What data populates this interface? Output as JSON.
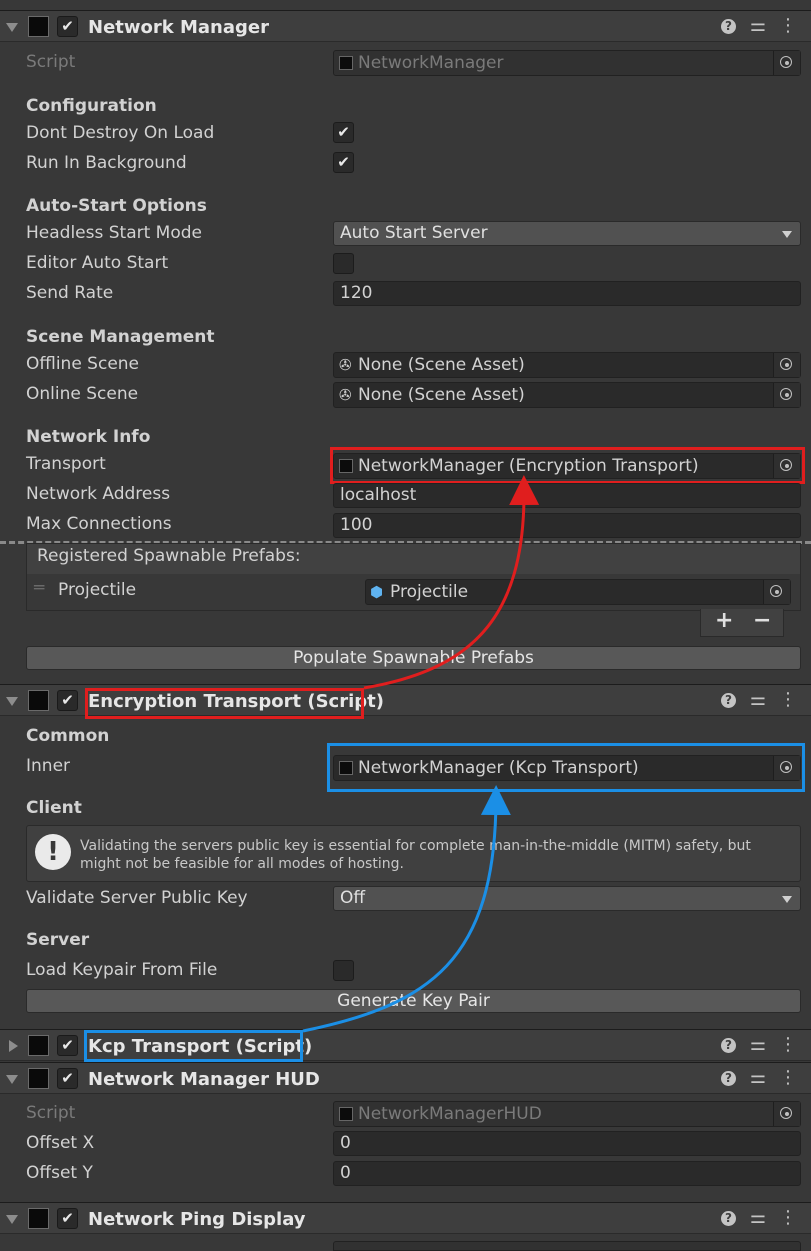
{
  "network_manager": {
    "title": "Network Manager",
    "script_label": "Script",
    "script_value": "NetworkManager",
    "configuration": {
      "heading": "Configuration",
      "dont_destroy_label": "Dont Destroy On Load",
      "dont_destroy_checked": true,
      "run_in_background_label": "Run In Background",
      "run_in_background_checked": true
    },
    "auto_start": {
      "heading": "Auto-Start Options",
      "headless_label": "Headless Start Mode",
      "headless_value": "Auto Start Server",
      "editor_auto_start_label": "Editor Auto Start",
      "editor_auto_start_checked": false,
      "send_rate_label": "Send Rate",
      "send_rate_value": "120"
    },
    "scene_management": {
      "heading": "Scene Management",
      "offline_label": "Offline Scene",
      "offline_value": "None (Scene Asset)",
      "online_label": "Online Scene",
      "online_value": "None (Scene Asset)"
    },
    "network_info": {
      "heading": "Network Info",
      "transport_label": "Transport",
      "transport_value": "NetworkManager (Encryption Transport)",
      "address_label": "Network Address",
      "address_value": "localhost",
      "max_connections_label": "Max Connections",
      "max_connections_value": "100"
    },
    "spawnable": {
      "heading": "Registered Spawnable Prefabs:",
      "item_label": "Projectile",
      "item_value": "Projectile",
      "add_symbol": "+",
      "remove_symbol": "−",
      "populate_button": "Populate Spawnable Prefabs"
    }
  },
  "encryption_transport": {
    "title": "Encryption Transport (Script)",
    "common_heading": "Common",
    "inner_label": "Inner",
    "inner_value": "NetworkManager (Kcp Transport)",
    "client_heading": "Client",
    "warning_text": "Validating the servers public key is essential for complete man-in-the-middle (MITM) safety, but might not be feasible for all modes of hosting.",
    "validate_label": "Validate Server Public Key",
    "validate_value": "Off",
    "server_heading": "Server",
    "load_keypair_label": "Load Keypair From File",
    "load_keypair_checked": false,
    "generate_button": "Generate Key Pair"
  },
  "kcp_transport": {
    "title": "Kcp Transport (Script)"
  },
  "network_manager_hud": {
    "title": "Network Manager HUD",
    "script_label": "Script",
    "script_value": "NetworkManagerHUD",
    "offset_x_label": "Offset X",
    "offset_x_value": "0",
    "offset_y_label": "Offset Y",
    "offset_y_value": "0"
  },
  "network_ping_display": {
    "title": "Network Ping Display"
  },
  "colors": {
    "highlight_red": "#e01e1e",
    "highlight_blue": "#1b8fe6"
  }
}
